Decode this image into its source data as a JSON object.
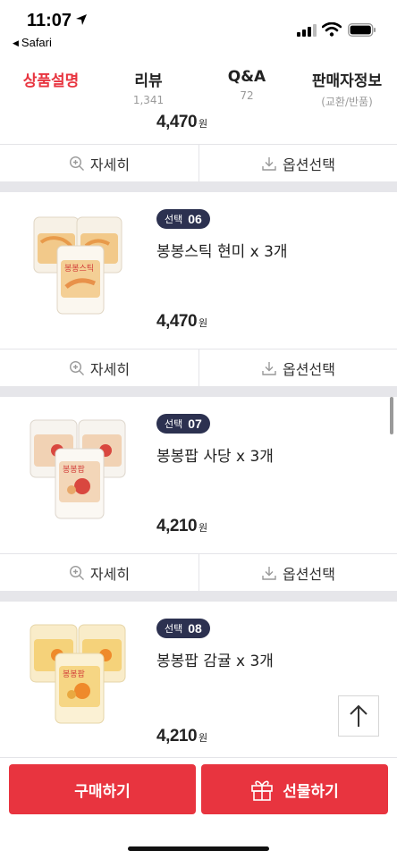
{
  "status_bar": {
    "time": "11:07",
    "back_app": "Safari"
  },
  "tabs": [
    {
      "label": "상품설명",
      "sub": "",
      "active": true
    },
    {
      "label": "리뷰",
      "sub": "1,341",
      "active": false
    },
    {
      "label": "Q&A",
      "sub": "72",
      "active": false
    },
    {
      "label": "판매자정보",
      "sub": "(교환/반품)",
      "active": false
    }
  ],
  "currency_unit": "원",
  "prev_item": {
    "price": "4,470"
  },
  "actions": {
    "detail": "자세히",
    "option": "옵션선택"
  },
  "products": [
    {
      "badge_label": "선택",
      "badge_num": "06",
      "name": "봉봉스틱 현미 x 3개",
      "price": "4,470",
      "image_icon": "rice-stick-snack-pouches"
    },
    {
      "badge_label": "선택",
      "badge_num": "07",
      "name": "봉봉팝 사당 x 3개",
      "price": "4,210",
      "image_icon": "pop-snack-pouches-strawberry"
    },
    {
      "badge_label": "선택",
      "badge_num": "08",
      "name": "봉봉팝 감귤 x 3개",
      "price": "4,210",
      "image_icon": "pop-snack-pouches-tangerine"
    }
  ],
  "bottom": {
    "buy": "구매하기",
    "gift": "선물하기"
  },
  "colors": {
    "accent": "#e8343f",
    "badge": "#2c3150",
    "divider": "#e6e6ea"
  }
}
